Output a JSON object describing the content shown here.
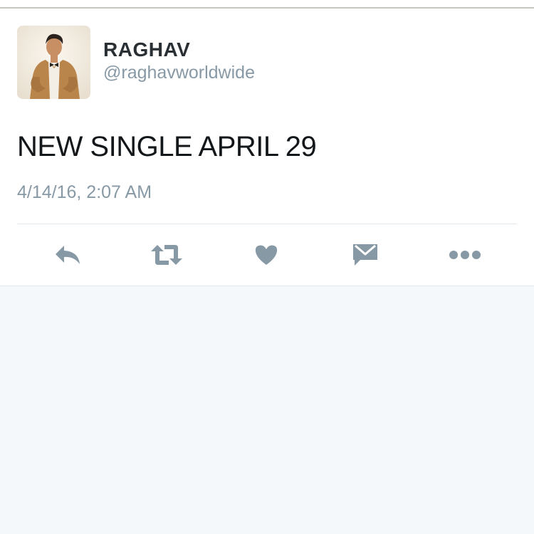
{
  "tweet": {
    "display_name": "RAGHAV",
    "handle": "@raghavworldwide",
    "text": "NEW SINGLE APRIL 29",
    "timestamp": "4/14/16, 2:07 AM"
  },
  "actions": [
    {
      "name": "reply",
      "icon": "reply-icon"
    },
    {
      "name": "retweet",
      "icon": "retweet-icon"
    },
    {
      "name": "like",
      "icon": "heart-icon"
    },
    {
      "name": "direct-message",
      "icon": "envelope-icon"
    },
    {
      "name": "more",
      "icon": "more-icon"
    }
  ],
  "colors": {
    "icon": "#8899a6",
    "name": "#292f33",
    "muted": "#8899a6",
    "background": "#f5f8fa",
    "card": "#ffffff"
  }
}
